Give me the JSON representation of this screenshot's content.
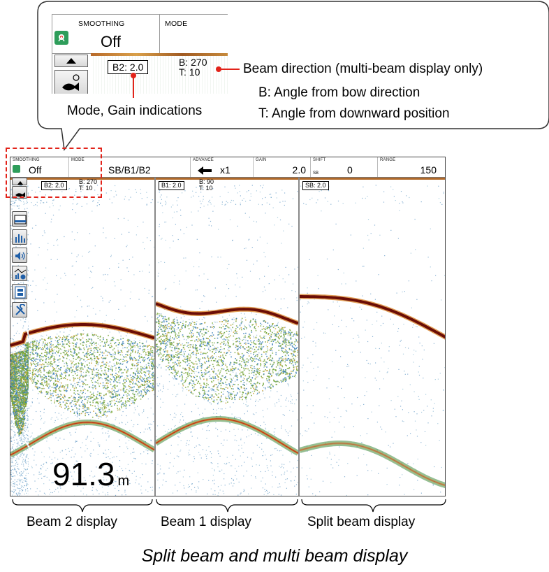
{
  "callout": {
    "smoothing_label": "SMOOTHING",
    "smoothing_value": "Off",
    "mode_label": "MODE",
    "gain_box": "B2:  2.0",
    "beam_b": "B: 270",
    "beam_t": "T: 10",
    "annotation_beam_direction": "Beam direction (multi-beam display only)",
    "annotation_b": "B: Angle from bow direction",
    "annotation_t": "T: Angle from downward position",
    "annotation_mode_gain": "Mode, Gain indications"
  },
  "topbar": {
    "smoothing_label": "SMOOTHING",
    "smoothing_value": "Off",
    "mode_label": "MODE",
    "mode_value": "SB/B1/B2",
    "advance_label": "ADVANCE",
    "advance_value": "x1",
    "gain_label": "GAIN",
    "gain_value": "2.0",
    "shift_label": "SHIFT",
    "shift_sub": "SB",
    "shift_value": "0",
    "range_label": "RANGE",
    "range_value": "150"
  },
  "panels": [
    {
      "box": "B2:  2.0",
      "b": "B: 270",
      "t": "T: 10"
    },
    {
      "box": "B1:  2.0",
      "b": "B: 90",
      "t": "T: 10"
    },
    {
      "box": "SB:  2.0",
      "b": "",
      "t": ""
    }
  ],
  "depth": {
    "value": "91.3",
    "unit": "m"
  },
  "labels": {
    "beam2": "Beam 2 display",
    "beam1": "Beam 1 display",
    "split": "Split beam display"
  },
  "caption": "Split beam and multi beam display",
  "colors": {
    "bottom_echo": "#6b0d06",
    "fish_green": "#7aa83a",
    "plankton_blue": "#3a7fb8",
    "pointer_red": "#e2231a",
    "highlight_dash": "#e2231a"
  },
  "icons": [
    "pin-icon",
    "up-arrow-icon",
    "fish-icon",
    "bottom-icon",
    "bar-graph-icon",
    "speaker-icon",
    "chart-icon",
    "film-icon",
    "tools-icon"
  ]
}
